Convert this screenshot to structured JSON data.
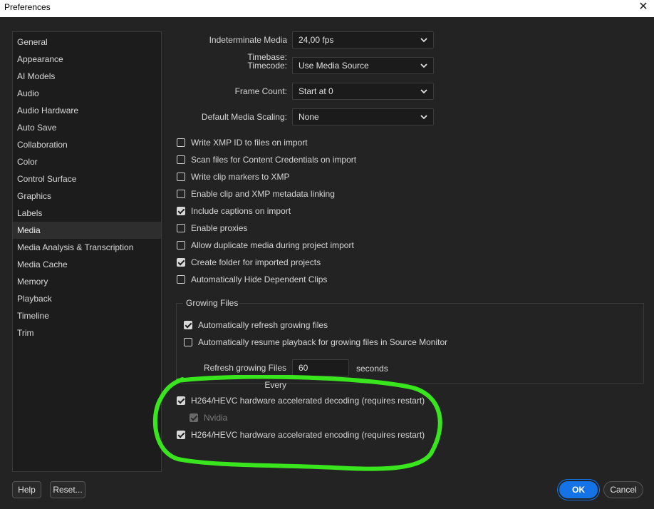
{
  "window": {
    "title": "Preferences"
  },
  "sidebar": {
    "items": [
      {
        "label": "General"
      },
      {
        "label": "Appearance"
      },
      {
        "label": "AI Models"
      },
      {
        "label": "Audio"
      },
      {
        "label": "Audio Hardware"
      },
      {
        "label": "Auto Save"
      },
      {
        "label": "Collaboration"
      },
      {
        "label": "Color"
      },
      {
        "label": "Control Surface"
      },
      {
        "label": "Graphics"
      },
      {
        "label": "Labels"
      },
      {
        "label": "Media"
      },
      {
        "label": "Media Analysis & Transcription"
      },
      {
        "label": "Media Cache"
      },
      {
        "label": "Memory"
      },
      {
        "label": "Playback"
      },
      {
        "label": "Timeline"
      },
      {
        "label": "Trim"
      }
    ],
    "selected": "Media"
  },
  "settings": {
    "fields": [
      {
        "label": "Indeterminate Media Timebase:",
        "value": "24,00 fps"
      },
      {
        "label": "Timecode:",
        "value": "Use Media Source"
      },
      {
        "label": "Frame Count:",
        "value": "Start at 0"
      },
      {
        "label": "Default Media Scaling:",
        "value": "None"
      }
    ],
    "checkboxes": [
      {
        "label": "Write XMP ID to files on import",
        "checked": false
      },
      {
        "label": "Scan files for Content Credentials on import",
        "checked": false
      },
      {
        "label": "Write clip markers to XMP",
        "checked": false
      },
      {
        "label": "Enable clip and XMP metadata linking",
        "checked": false
      },
      {
        "label": "Include captions on import",
        "checked": true
      },
      {
        "label": "Enable proxies",
        "checked": false
      },
      {
        "label": "Allow duplicate media during project import",
        "checked": false
      },
      {
        "label": "Create folder for imported projects",
        "checked": true
      },
      {
        "label": "Automatically Hide Dependent Clips",
        "checked": false
      }
    ]
  },
  "growing_files": {
    "title": "Growing Files",
    "checkboxes": [
      {
        "label": "Automatically refresh growing files",
        "checked": true
      },
      {
        "label": "Automatically resume playback for growing files in Source Monitor",
        "checked": false
      }
    ],
    "refresh_label": "Refresh growing Files Every",
    "refresh_value": "60",
    "refresh_unit": "seconds"
  },
  "hardware": {
    "decoding": {
      "label": "H264/HEVC hardware accelerated decoding (requires restart)",
      "checked": true
    },
    "nvidia": {
      "label": "Nvidia",
      "checked": true,
      "disabled": true
    },
    "encoding": {
      "label": "H264/HEVC hardware accelerated encoding (requires restart)",
      "checked": true
    }
  },
  "footer": {
    "help": "Help",
    "reset": "Reset...",
    "ok": "OK",
    "cancel": "Cancel"
  },
  "colors": {
    "background": "#232323",
    "accent": "#1473e6",
    "annotation": "#39e61e"
  }
}
